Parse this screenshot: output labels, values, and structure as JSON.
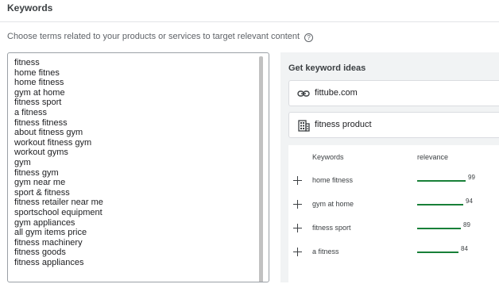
{
  "section": {
    "title": "Keywords",
    "description": "Choose terms related to your products or services to target relevant content",
    "help_icon_glyph": "?"
  },
  "keywords_text": [
    "fitness",
    "home fitnes",
    "home fitness",
    "gym at home",
    "fitness sport",
    "a fitness",
    "fitness fitness",
    "about fitness gym",
    "workout fitness gym",
    "workout gyms",
    "gym",
    "fitness gym",
    "gym near me",
    "sport & fitness",
    "fitness retailer near me",
    "sportschool equipment",
    "gym appliances",
    "all gym items price",
    "fitness machinery",
    "fitness goods",
    "fitness appliances"
  ],
  "ideas": {
    "title": "Get keyword ideas",
    "url_value": "fittube.com",
    "url_icon": "link-icon",
    "product_value": "fitness product",
    "product_icon": "building-icon",
    "columns": {
      "keywords": "Keywords",
      "relevance": "relevance"
    },
    "rows": [
      {
        "keyword": "home fitness",
        "relevance": 99,
        "relevance_label": "99"
      },
      {
        "keyword": "gym at home",
        "relevance": 94,
        "relevance_label": "94"
      },
      {
        "keyword": "fitness sport",
        "relevance": 89,
        "relevance_label": "89"
      },
      {
        "keyword": "a fitness",
        "relevance": 84,
        "relevance_label": "84"
      }
    ]
  },
  "colors": {
    "relevance_bar": "#188038",
    "panel_bg": "#f1f3f4"
  }
}
